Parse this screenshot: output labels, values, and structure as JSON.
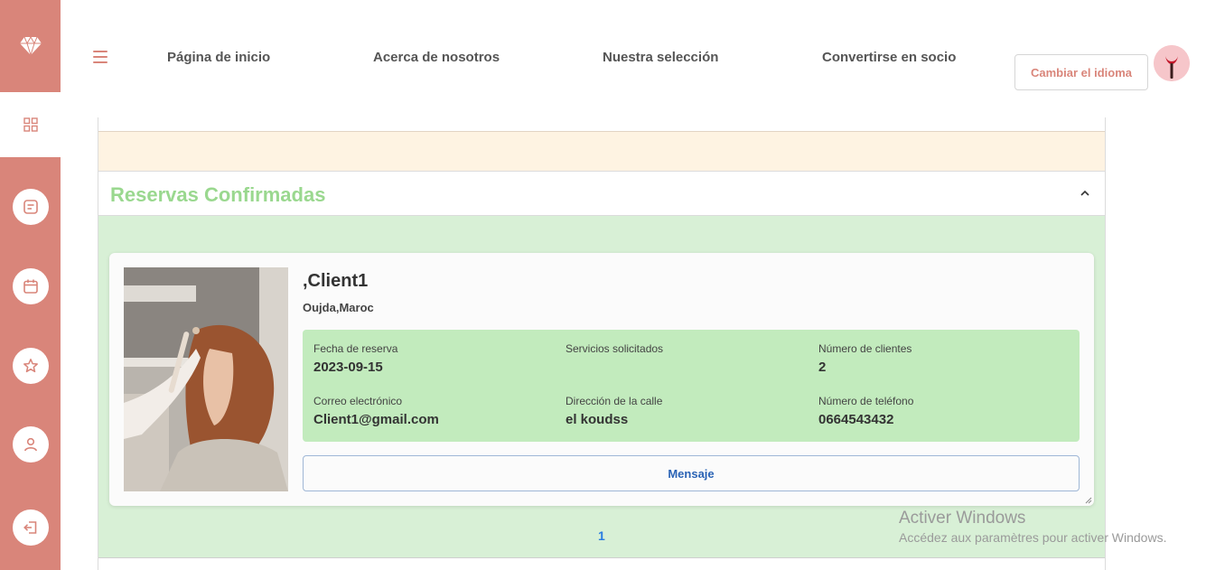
{
  "sidebar": {
    "icons": [
      "diamond-icon",
      "dashboard-icon",
      "message-icon",
      "calendar-icon",
      "star-icon",
      "user-icon",
      "logout-icon"
    ]
  },
  "nav": {
    "links": [
      "Página de inicio",
      "Acerca de nosotros",
      "Nuestra selección",
      "Convertirse en socio"
    ],
    "lang_button": "Cambiar el idioma"
  },
  "section": {
    "title": "Reservas Confirmadas"
  },
  "card": {
    "name": ",Client1",
    "location": "Oujda,Maroc",
    "fields": [
      {
        "label": "Fecha de reserva",
        "value": "2023-09-15"
      },
      {
        "label": "Servicios solicitados",
        "value": ""
      },
      {
        "label": "Número de clientes",
        "value": "2"
      },
      {
        "label": "Correo electrónico",
        "value": "Client1@gmail.com"
      },
      {
        "label": "Dirección de la calle",
        "value": "el koudss"
      },
      {
        "label": "Número de teléfono",
        "value": "0664543432"
      }
    ],
    "message_button": "Mensaje"
  },
  "pagination": {
    "current": "1"
  },
  "watermark": {
    "title": "Activer Windows",
    "subtitle": "Accédez aux paramètres pour activer Windows."
  },
  "colors": {
    "accent": "#d9857a",
    "section_title": "#9ad88f",
    "info_bg": "#c2ebbd",
    "body_bg": "#d8f0d6",
    "link_blue": "#2a7de1"
  }
}
